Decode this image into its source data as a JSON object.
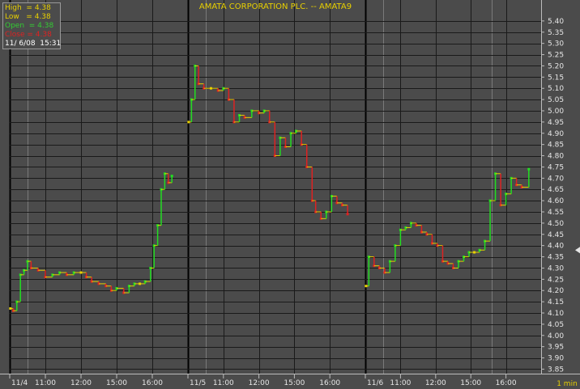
{
  "chart_data": {
    "type": "line",
    "title": "AMATA CORPORATION PLC.  --  AMATA9",
    "interval_label": "1  min",
    "info_box": [
      {
        "label": "High",
        "value": "4.38",
        "color": "#e8d000"
      },
      {
        "label": "Low",
        "value": "4.38",
        "color": "#e8d000"
      },
      {
        "label": "Open",
        "value": "4.38",
        "color": "#33cc33"
      },
      {
        "label": "Close",
        "value": "4.38",
        "color": "#dd2222"
      },
      {
        "label": "",
        "value": "11/ 6/08  15:31",
        "color": "#ffffff"
      }
    ],
    "y_ticks": [
      "3.85",
      "3.90",
      "3.95",
      "4.00",
      "4.05",
      "4.10",
      "4.15",
      "4.20",
      "4.25",
      "4.30",
      "4.35",
      "4.40",
      "4.45",
      "4.50",
      "4.55",
      "4.60",
      "4.65",
      "4.70",
      "4.75",
      "4.80",
      "4.85",
      "4.90",
      "4.95",
      "5.00",
      "5.05",
      "5.10",
      "5.15",
      "5.20",
      "5.25",
      "5.30",
      "5.35",
      "5.40"
    ],
    "ylim": [
      3.83,
      5.45
    ],
    "x_ticks": [
      {
        "label": "11/4",
        "x": 0
      },
      {
        "label": "11:00",
        "x": 1
      },
      {
        "label": "12:00",
        "x": 2
      },
      {
        "label": "15:00",
        "x": 3
      },
      {
        "label": "16:00",
        "x": 4
      },
      {
        "label": "11/5",
        "x": 5
      },
      {
        "label": "11:00",
        "x": 6
      },
      {
        "label": "12:00",
        "x": 7
      },
      {
        "label": "15:00",
        "x": 8
      },
      {
        "label": "16:00",
        "x": 9
      },
      {
        "label": "11/6",
        "x": 10
      },
      {
        "label": "11:00",
        "x": 11
      },
      {
        "label": "12:00",
        "x": 12
      },
      {
        "label": "15:00",
        "x": 13
      },
      {
        "label": "16:00",
        "x": 14
      }
    ],
    "xlim": [
      0,
      15
    ],
    "day_dividers": [
      0,
      5,
      10
    ],
    "current_price": 4.38,
    "series": [
      {
        "points": [
          [
            0.02,
            4.12
          ],
          [
            0.1,
            4.11
          ],
          [
            0.2,
            4.15
          ],
          [
            0.3,
            4.27
          ],
          [
            0.4,
            4.29
          ],
          [
            0.5,
            4.33
          ],
          [
            0.6,
            4.3
          ],
          [
            0.8,
            4.29
          ],
          [
            1.0,
            4.26
          ],
          [
            1.2,
            4.27
          ],
          [
            1.4,
            4.28
          ],
          [
            1.6,
            4.27
          ],
          [
            1.8,
            4.28
          ],
          [
            2.0,
            4.28
          ],
          [
            2.15,
            4.26
          ],
          [
            2.3,
            4.24
          ],
          [
            2.5,
            4.23
          ],
          [
            2.7,
            4.22
          ],
          [
            2.85,
            4.2
          ],
          [
            3.0,
            4.21
          ],
          [
            3.2,
            4.19
          ],
          [
            3.35,
            4.22
          ],
          [
            3.5,
            4.23
          ],
          [
            3.65,
            4.23
          ],
          [
            3.8,
            4.24
          ],
          [
            3.95,
            4.3
          ],
          [
            4.05,
            4.4
          ],
          [
            4.15,
            4.49
          ],
          [
            4.25,
            4.65
          ],
          [
            4.35,
            4.72
          ],
          [
            4.45,
            4.68
          ],
          [
            4.55,
            4.71
          ],
          [
            5.02,
            4.95
          ],
          [
            5.1,
            5.05
          ],
          [
            5.2,
            5.2
          ],
          [
            5.3,
            5.12
          ],
          [
            5.45,
            5.1
          ],
          [
            5.65,
            5.1
          ],
          [
            5.85,
            5.09
          ],
          [
            6.0,
            5.1
          ],
          [
            6.15,
            5.05
          ],
          [
            6.3,
            4.95
          ],
          [
            6.45,
            4.98
          ],
          [
            6.6,
            4.97
          ],
          [
            6.8,
            5.0
          ],
          [
            7.0,
            4.99
          ],
          [
            7.15,
            5.0
          ],
          [
            7.3,
            4.95
          ],
          [
            7.45,
            4.8
          ],
          [
            7.6,
            4.88
          ],
          [
            7.75,
            4.84
          ],
          [
            7.9,
            4.9
          ],
          [
            8.05,
            4.91
          ],
          [
            8.2,
            4.85
          ],
          [
            8.35,
            4.75
          ],
          [
            8.5,
            4.6
          ],
          [
            8.6,
            4.55
          ],
          [
            8.75,
            4.52
          ],
          [
            8.9,
            4.55
          ],
          [
            9.05,
            4.62
          ],
          [
            9.2,
            4.59
          ],
          [
            9.35,
            4.58
          ],
          [
            9.5,
            4.54
          ],
          [
            10.02,
            4.22
          ],
          [
            10.1,
            4.35
          ],
          [
            10.25,
            4.31
          ],
          [
            10.4,
            4.3
          ],
          [
            10.55,
            4.28
          ],
          [
            10.7,
            4.33
          ],
          [
            10.85,
            4.4
          ],
          [
            11.0,
            4.47
          ],
          [
            11.15,
            4.48
          ],
          [
            11.3,
            4.5
          ],
          [
            11.45,
            4.49
          ],
          [
            11.6,
            4.46
          ],
          [
            11.75,
            4.45
          ],
          [
            11.9,
            4.41
          ],
          [
            12.05,
            4.4
          ],
          [
            12.2,
            4.33
          ],
          [
            12.35,
            4.32
          ],
          [
            12.5,
            4.3
          ],
          [
            12.65,
            4.33
          ],
          [
            12.8,
            4.35
          ],
          [
            12.95,
            4.37
          ],
          [
            13.1,
            4.37
          ],
          [
            13.25,
            4.38
          ],
          [
            13.4,
            4.42
          ],
          [
            13.55,
            4.6
          ],
          [
            13.7,
            4.72
          ],
          [
            13.85,
            4.58
          ],
          [
            14.0,
            4.63
          ],
          [
            14.15,
            4.7
          ],
          [
            14.3,
            4.67
          ],
          [
            14.45,
            4.66
          ],
          [
            14.65,
            4.74
          ]
        ]
      }
    ],
    "colors": {
      "background": "#4b4b4b",
      "grid": "#1a1a1a",
      "divider": "#000000",
      "up": "#22dd22",
      "down": "#dd2222",
      "flat": "#e8d000",
      "axis_text": "#e6e6e6",
      "title": "#e8d000"
    },
    "grid": true,
    "legend": "top-left"
  }
}
